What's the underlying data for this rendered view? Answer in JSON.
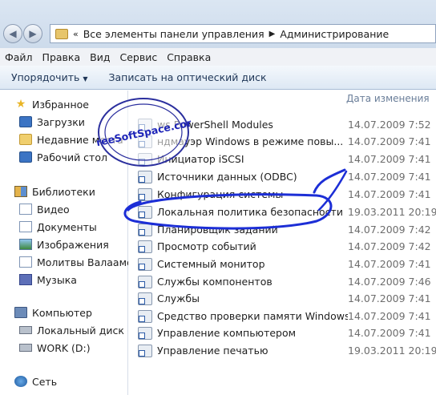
{
  "address": {
    "path": [
      "Все элементы панели управления",
      "Администрирование"
    ]
  },
  "menu": [
    "Файл",
    "Правка",
    "Вид",
    "Сервис",
    "Справка"
  ],
  "toolbar": {
    "organize": "Упорядочить",
    "burn": "Записать на оптический диск"
  },
  "nav": {
    "favorites": "Избранное",
    "downloads": "Загрузки",
    "recent": "Недавние места",
    "desktop": "Рабочий стол",
    "libraries": "Библиотеки",
    "video": "Видео",
    "documents": "Документы",
    "images": "Изображения",
    "prayers": "Молитвы Валаамские",
    "music": "Музыка",
    "computer": "Компьютер",
    "local_disk": "Локальный диск (C:)",
    "work": "WORK (D:)",
    "network": "Сеть"
  },
  "columns": {
    "date": "Дата изменения"
  },
  "files": [
    {
      "name": "ws PowerShell Modules",
      "date": "14.07.2009 7:52"
    },
    {
      "name": "ндмауэр Windows в режиме повы...",
      "date": "14.07.2009 7:41"
    },
    {
      "name": "Инициатор iSCSI",
      "date": "14.07.2009 7:41"
    },
    {
      "name": "Источники данных (ODBC)",
      "date": "14.07.2009 7:41"
    },
    {
      "name": "Конфигурация системы",
      "date": "14.07.2009 7:41"
    },
    {
      "name": "Локальная политика безопасности",
      "date": "19.03.2011 20:19"
    },
    {
      "name": "Планировщик заданий",
      "date": "14.07.2009 7:42"
    },
    {
      "name": "Просмотр событий",
      "date": "14.07.2009 7:42"
    },
    {
      "name": "Системный монитор",
      "date": "14.07.2009 7:41"
    },
    {
      "name": "Службы компонентов",
      "date": "14.07.2009 7:46"
    },
    {
      "name": "Службы",
      "date": "14.07.2009 7:41"
    },
    {
      "name": "Средство проверки памяти Windows",
      "date": "14.07.2009 7:41"
    },
    {
      "name": "Управление компьютером",
      "date": "14.07.2009 7:41"
    },
    {
      "name": "Управление печатью",
      "date": "19.03.2011 20:19"
    }
  ],
  "watermark": {
    "text": "FreeSoftSpace.com"
  }
}
